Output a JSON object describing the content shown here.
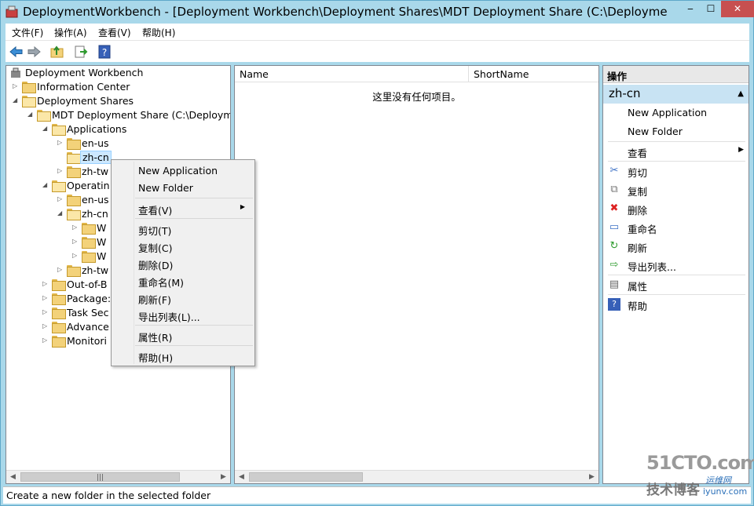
{
  "window": {
    "title": "DeploymentWorkbench - [Deployment Workbench\\Deployment Shares\\MDT Deployment Share (C:\\DeploymentS...",
    "min_label": "‒",
    "max_label": "☐",
    "close_label": "✕"
  },
  "menubar": {
    "file": "文件(F)",
    "action": "操作(A)",
    "view": "查看(V)",
    "help": "帮助(H)"
  },
  "toolbar": {
    "icons": [
      "back-icon",
      "forward-icon",
      "up-folder-icon",
      "export-list-icon",
      "help-icon"
    ]
  },
  "tree": {
    "root": "Deployment Workbench",
    "info_center": "Information Center",
    "deployment_shares": "Deployment Shares",
    "mdt_share": "MDT Deployment Share (C:\\Deployme",
    "applications": "Applications",
    "app_en_us": "en-us",
    "app_zh_cn": "zh-cn",
    "app_zh_tw": "zh-tw",
    "operating": "Operatin",
    "os_en_us": "en-us",
    "os_zh_cn": "zh-cn",
    "os_w1": "W",
    "os_w2": "W",
    "os_w3": "W",
    "os_zh_tw": "zh-tw",
    "out_of_box": "Out-of-B",
    "packages": "Package:",
    "task_seq": "Task Sec",
    "advanced": "Advance",
    "monitoring": "Monitori"
  },
  "list": {
    "col_name": "Name",
    "col_shortname": "ShortName",
    "empty_message": "这里没有任何项目。"
  },
  "actions": {
    "title": "操作",
    "selected": "zh-cn",
    "items": {
      "new_application": "New Application",
      "new_folder": "New Folder",
      "view": "查看",
      "cut": "剪切",
      "copy": "复制",
      "delete": "删除",
      "rename": "重命名",
      "refresh": "刷新",
      "export_list": "导出列表...",
      "properties": "属性",
      "help": "帮助"
    }
  },
  "context_menu": {
    "new_application": "New Application",
    "new_folder": "New Folder",
    "view": "查看(V)",
    "cut": "剪切(T)",
    "copy": "复制(C)",
    "delete": "删除(D)",
    "rename": "重命名(M)",
    "refresh": "刷新(F)",
    "export_list": "导出列表(L)...",
    "properties": "属性(R)",
    "help": "帮助(H)"
  },
  "statusbar": {
    "text": "Create a new folder in the selected folder"
  },
  "watermark": {
    "line1": "51CTO.com",
    "line2": "技术博客",
    "line3": "运维网",
    "line4": "iyunv.com"
  }
}
